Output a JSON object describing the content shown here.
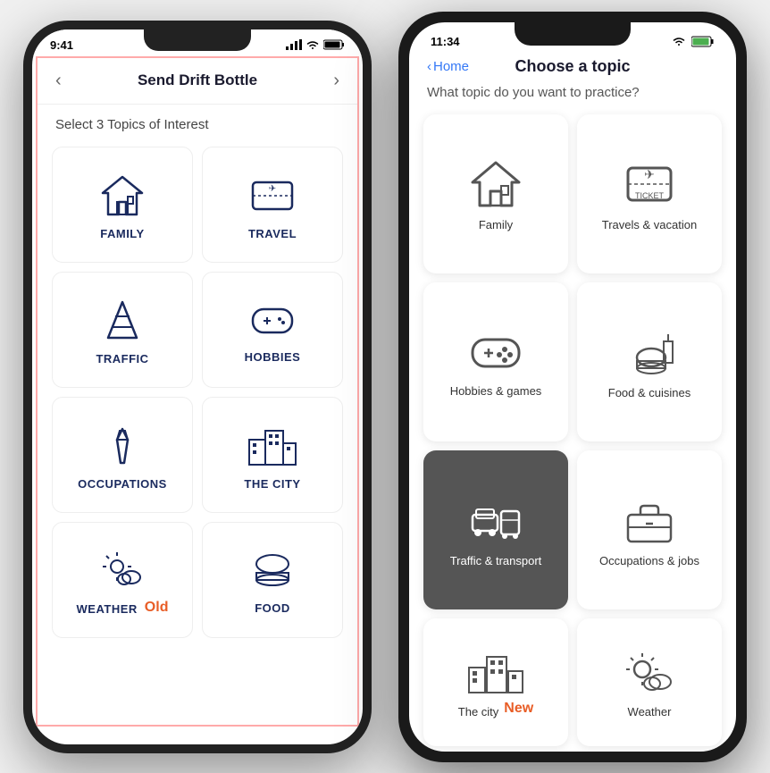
{
  "old_phone": {
    "time": "9:41",
    "title": "Send Drift Bottle",
    "subtitle": "Select 3 Topics of Interest",
    "badge": "Old",
    "topics": [
      {
        "id": "family",
        "label": "FAMILY",
        "icon": "house"
      },
      {
        "id": "travel",
        "label": "TRAVEL",
        "icon": "ticket"
      },
      {
        "id": "traffic",
        "label": "TRAFFIC",
        "icon": "cone"
      },
      {
        "id": "hobbies",
        "label": "HOBBIES",
        "icon": "gamepad"
      },
      {
        "id": "occupations",
        "label": "OCCUPATIONS",
        "icon": "tie"
      },
      {
        "id": "city",
        "label": "THE CITY",
        "icon": "buildings"
      },
      {
        "id": "weather",
        "label": "WEATHER",
        "icon": "sun-cloud"
      },
      {
        "id": "food",
        "label": "FOOD",
        "icon": "burger"
      }
    ]
  },
  "new_phone": {
    "time": "11:34",
    "back_label": "Home",
    "title": "Choose a topic",
    "subtitle": "What topic do you want to practice?",
    "badge": "New",
    "topics": [
      {
        "id": "family",
        "label": "Family",
        "icon": "house",
        "dark": false
      },
      {
        "id": "travels",
        "label": "Travels & vacation",
        "icon": "ticket",
        "dark": false
      },
      {
        "id": "hobbies",
        "label": "Hobbies & games",
        "icon": "gamepad",
        "dark": false
      },
      {
        "id": "food",
        "label": "Food & cuisines",
        "icon": "food",
        "dark": false
      },
      {
        "id": "traffic",
        "label": "Traffic & transport",
        "icon": "traffic",
        "dark": true
      },
      {
        "id": "occupations",
        "label": "Occupations & jobs",
        "icon": "briefcase",
        "dark": false
      },
      {
        "id": "city",
        "label": "The city",
        "icon": "buildings",
        "dark": false
      },
      {
        "id": "weather",
        "label": "Weather",
        "icon": "sun-cloud",
        "dark": false
      }
    ]
  }
}
